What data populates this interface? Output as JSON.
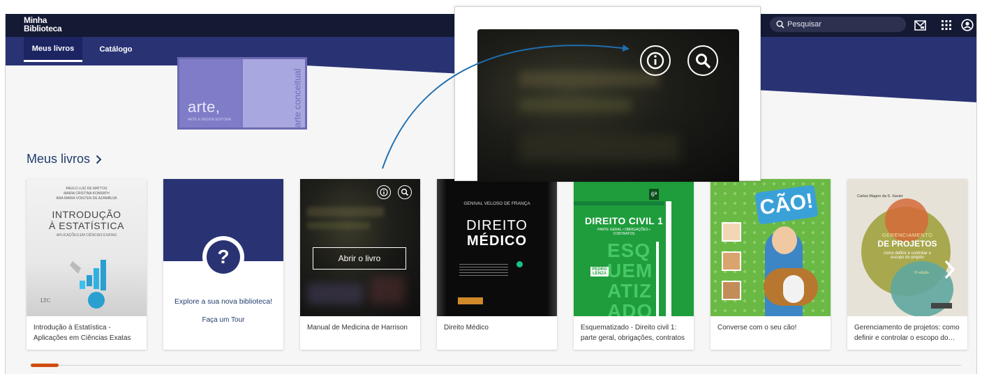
{
  "header": {
    "brand_line1": "Minha",
    "brand_line2": "Biblioteca",
    "search_placeholder": "Pesquisar",
    "icons": [
      "search-icon",
      "reader-icon",
      "apps-grid-icon",
      "account-icon"
    ]
  },
  "nav": {
    "tabs": [
      {
        "label": "Meus livros",
        "active": true
      },
      {
        "label": "Catálogo",
        "active": false
      }
    ]
  },
  "banner": {
    "word": "arte,",
    "sub": "ARTE E DESIGN EDITORA",
    "vertical": "arte conceitual"
  },
  "section": {
    "title": "Meus livros"
  },
  "books": [
    {
      "title": "Introdução à Estatística - Aplicações em Ciências Exatas",
      "cover_authors": [
        "PAULO LUIZ DE MATTOS",
        "MARIA CRISTINA KONRATH",
        "ANA MARIA VOIGTEN DE AZAMBUJA"
      ],
      "cover_title_1": "INTRODUÇÃO",
      "cover_title_2": "À ESTATÍSTICA",
      "cover_subtitle": "APLICAÇÕES EM CIÊNCIAS EXATAS",
      "cover_publisher": "LTC"
    },
    {
      "type": "explore",
      "title": "Explore a sua nova biblioteca!",
      "link": "Faça um Tour",
      "symbol": "?"
    },
    {
      "title": "Manual de Medicina de Harrison",
      "action_label": "Abrir o livro",
      "hovered": true
    },
    {
      "title": "Direito Médico",
      "cover_author": "GENIVAL VELOSO DE FRANÇA",
      "cover_title_1": "DIREITO",
      "cover_title_2": "MÉDICO"
    },
    {
      "title": "Esquematizado - Direito civil 1: parte geral, obrigações, contratos",
      "cover_edition": "6ª",
      "cover_title": "DIREITO CIVIL 1",
      "cover_subtitle": "PARTE GERAL • OBRIGAÇÕES • CONTRATOS",
      "cover_word": "ESQUEMATIZADO",
      "cover_author": "PEDRO LENZA"
    },
    {
      "title": "Converse com o seu cão!",
      "cover_title": "CÃO!"
    },
    {
      "title": "Gerenciamento de projetos: como definir e controlar o escopo do projeto",
      "cover_author": "Carlos Magno da S. Xavier",
      "cover_title_1": "GERENCIAMENTO",
      "cover_title_2": "DE PROJETOS",
      "cover_subtitle": "como definir e controlar o escopo do projeto",
      "cover_edition": "3ª edição"
    }
  ],
  "zoom_callout": {
    "icons": [
      "info-icon",
      "search-icon"
    ]
  },
  "colors": {
    "topbar": "#141934",
    "navbar": "#293374",
    "accent": "#203c6d",
    "scroll_thumb": "#d14e10",
    "green_cover": "#1f9d3c"
  }
}
